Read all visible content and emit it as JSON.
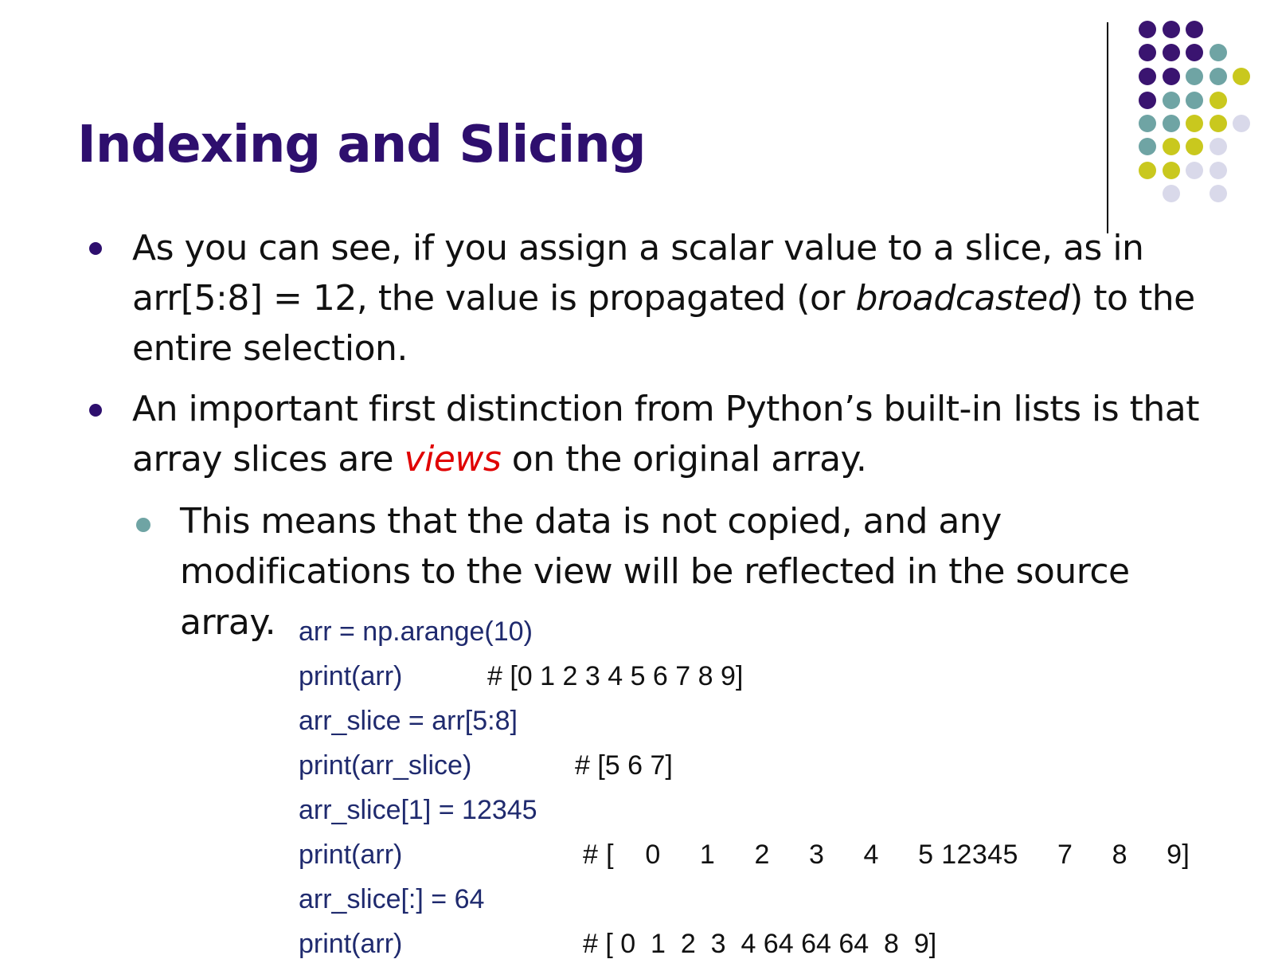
{
  "slide": {
    "title": "Indexing and Slicing",
    "colors": {
      "title": "#2e0f6e",
      "bullet": "#2e0f6e",
      "sub_bullet": "#6fa4a4",
      "code": "#1f2a6e",
      "highlight": "#e00000",
      "dot_purple": "#3a1470",
      "dot_teal": "#6fa4a4",
      "dot_yellow": "#c9c81e",
      "dot_lavender": "#d9d9ea"
    },
    "bullet1": {
      "line1": "As you can see, if you assign a scalar value to a slice, as in",
      "line2_a": "arr[5:8] = 12, the value is propagated (or ",
      "line2_em": "broadcasted",
      "line2_b": ") to the",
      "line3": "entire selection."
    },
    "bullet2": {
      "line1": "An important first distinction from Python’s built-in lists is that",
      "line2_a": "array slices are ",
      "line2_em": "views",
      "line2_b": " on the original array."
    },
    "sub_bullet": {
      "line1": "This means that the data is not copied, and any",
      "line2": "modifications to the view will be reflected in the source",
      "line3": "array."
    },
    "code": {
      "l1": "arr = np.arange(10)",
      "l2": "print(arr)",
      "c2": "# [0 1 2 3 4 5 6 7 8 9]",
      "l3": "arr_slice = arr[5:8]",
      "l4": "print(arr_slice)",
      "c4": "# [5 6 7]",
      "l5": "arr_slice[1] = 12345",
      "l6": "print(arr)",
      "c6": "# [    0     1     2     3     4     5 12345     7     8     9]",
      "l7": "arr_slice[:] = 64",
      "l8": "print(arr)",
      "c8": "# [ 0  1  2  3  4 64 64 64  8  9]"
    }
  }
}
